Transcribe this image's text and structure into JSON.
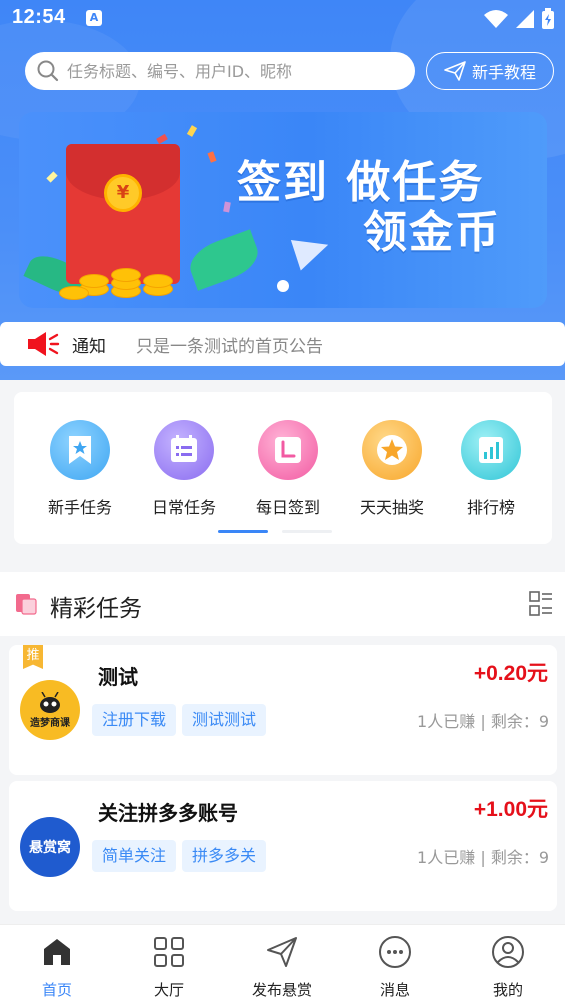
{
  "status_bar": {
    "time": "12:54",
    "indicator": "A"
  },
  "search": {
    "placeholder": "任务标题、编号、用户ID、昵称"
  },
  "tutorial_button": {
    "label": "新手教程"
  },
  "banner": {
    "line1": "签到 做任务",
    "line2": "领金币",
    "coin_symbol": "¥"
  },
  "notice": {
    "label": "通知",
    "text": "只是一条测试的首页公告"
  },
  "menu": [
    {
      "label": "新手任务",
      "icon": "bookmark-star-icon",
      "color": "#3fa6f2"
    },
    {
      "label": "日常任务",
      "icon": "list-icon",
      "color": "#8a6cf0"
    },
    {
      "label": "每日签到",
      "icon": "calendar-icon",
      "color": "#f25aa2"
    },
    {
      "label": "天天抽奖",
      "icon": "star-icon",
      "color": "#f8a62a"
    },
    {
      "label": "排行榜",
      "icon": "bar-chart-icon",
      "color": "#2fc5d6"
    }
  ],
  "section": {
    "title": "精彩任务"
  },
  "tasks": [
    {
      "badge": "推",
      "avatar_text": "造梦商课",
      "title": "测试",
      "price": "+0.20元",
      "tags": [
        "注册下载",
        "测试测试"
      ],
      "earned": "1人已赚",
      "separator": "|",
      "remaining": "剩余：9"
    },
    {
      "badge": "",
      "avatar_text": "悬赏窝",
      "title": "关注拼多多账号",
      "price": "+1.00元",
      "tags": [
        "简单关注",
        "拼多多关"
      ],
      "earned": "1人已赚",
      "separator": "|",
      "remaining": "剩余：9"
    }
  ],
  "tabs": [
    {
      "label": "首页",
      "icon": "home-icon",
      "active": true
    },
    {
      "label": "大厅",
      "icon": "grid-icon",
      "active": false
    },
    {
      "label": "发布悬赏",
      "icon": "send-icon",
      "active": false
    },
    {
      "label": "消息",
      "icon": "message-icon",
      "active": false
    },
    {
      "label": "我的",
      "icon": "user-icon",
      "active": false
    }
  ],
  "colors": {
    "primary": "#3a86f7",
    "price": "#e5101a",
    "tag_bg": "#e9f3ff"
  }
}
